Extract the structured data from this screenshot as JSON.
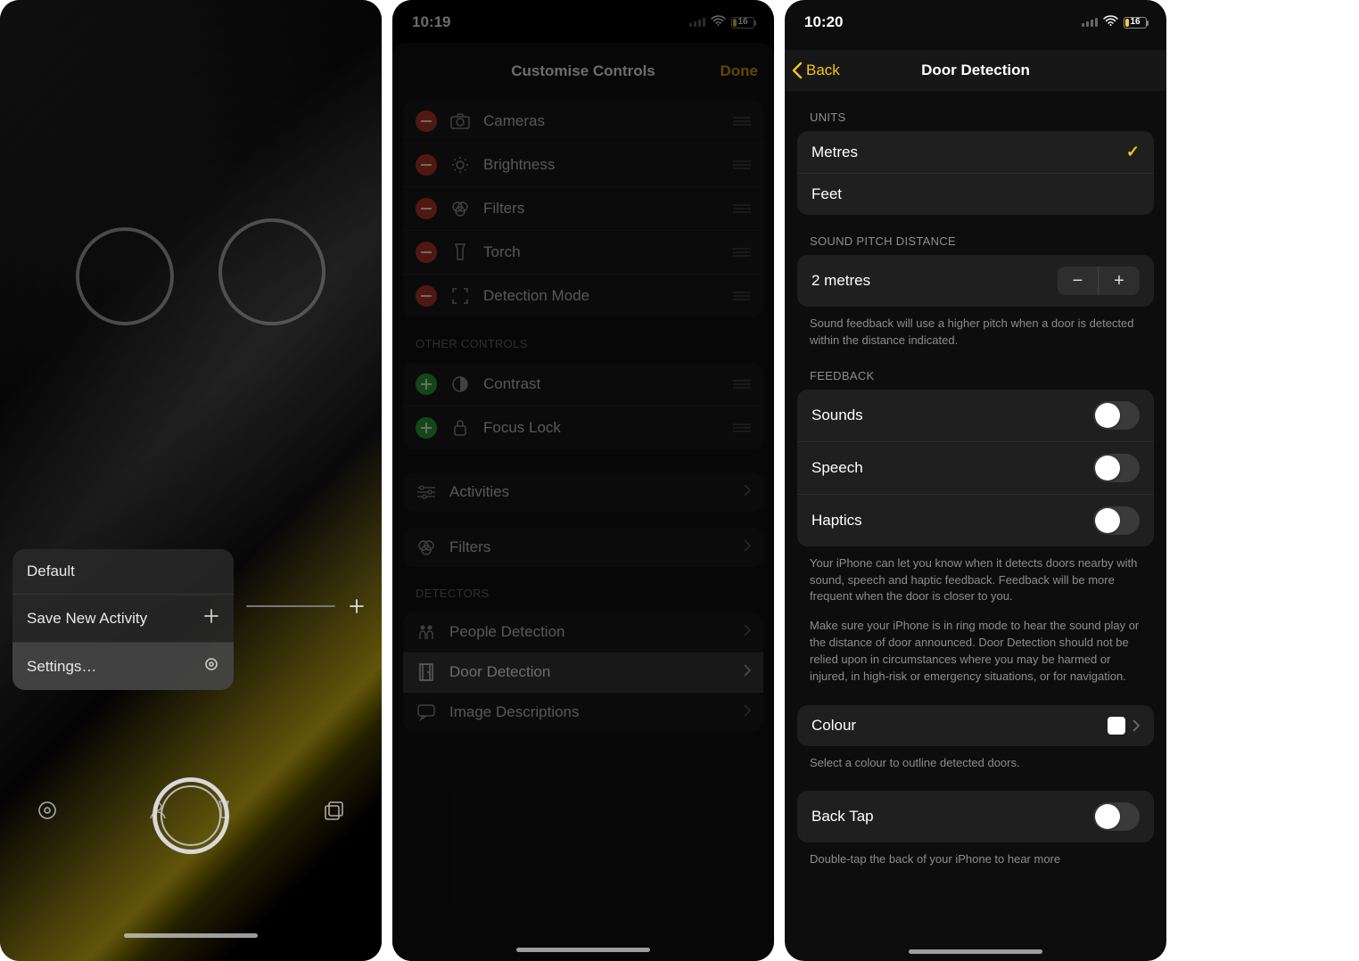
{
  "screen1": {
    "menu": {
      "default": "Default",
      "save": "Save New Activity",
      "settings": "Settings…"
    }
  },
  "screen2": {
    "status": {
      "time": "10:19",
      "battery": "16"
    },
    "sheet": {
      "title": "Customise Controls",
      "done": "Done",
      "main": [
        {
          "label": "Cameras"
        },
        {
          "label": "Brightness"
        },
        {
          "label": "Filters"
        },
        {
          "label": "Torch"
        },
        {
          "label": "Detection Mode"
        }
      ],
      "other_header": "OTHER CONTROLS",
      "other": [
        {
          "label": "Contrast"
        },
        {
          "label": "Focus Lock"
        }
      ],
      "links": {
        "activities": "Activities",
        "filters": "Filters"
      },
      "detectors_header": "DETECTORS",
      "detectors": [
        {
          "label": "People Detection"
        },
        {
          "label": "Door Detection",
          "selected": true
        },
        {
          "label": "Image Descriptions"
        }
      ]
    }
  },
  "screen3": {
    "status": {
      "time": "10:20",
      "battery": "16"
    },
    "nav": {
      "back": "Back",
      "title": "Door Detection"
    },
    "units": {
      "header": "UNITS",
      "metres": "Metres",
      "feet": "Feet"
    },
    "pitch": {
      "header": "SOUND PITCH DISTANCE",
      "value": "2 metres",
      "note": "Sound feedback will use a higher pitch when a door is detected within the distance indicated."
    },
    "feedback": {
      "header": "FEEDBACK",
      "sounds": "Sounds",
      "speech": "Speech",
      "haptics": "Haptics",
      "note1": "Your iPhone can let you know when it detects doors nearby with sound, speech and haptic feedback. Feedback will be more frequent when the door is closer to you.",
      "note2": "Make sure your iPhone is in ring mode to hear the sound play or the distance of door announced. Door Detection should not be relied upon in circumstances where you may be harmed or injured, in high-risk or emergency situations, or for navigation."
    },
    "colour": {
      "label": "Colour",
      "note": "Select a colour to outline detected doors."
    },
    "backtap": {
      "label": "Back Tap",
      "note": "Double-tap the back of your iPhone to hear more"
    }
  }
}
